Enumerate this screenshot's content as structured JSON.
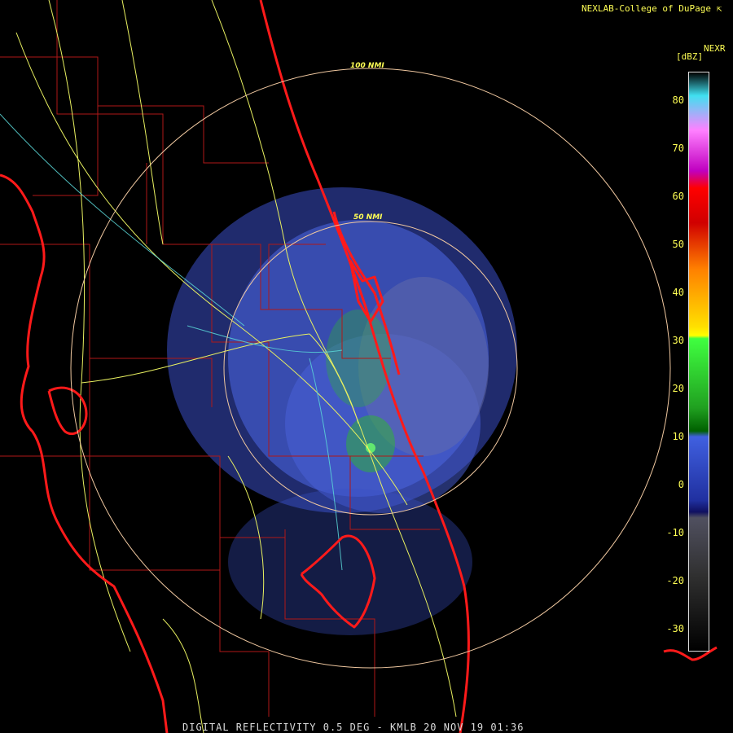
{
  "header": {
    "credit": "NEXLAB-College of DuPage"
  },
  "legend": {
    "product": "NEXR",
    "unit": "[dBZ]",
    "ticks": [
      "80",
      "70",
      "60",
      "50",
      "40",
      "30",
      "20",
      "10",
      "0",
      "-10",
      "-20",
      "-30"
    ],
    "tick_values": [
      80,
      70,
      60,
      50,
      40,
      30,
      20,
      10,
      0,
      -10,
      -20,
      -30
    ]
  },
  "rings": {
    "inner": "50 NMI",
    "outer": "100 NMI"
  },
  "footer": {
    "caption": "DIGITAL REFLECTIVITY 0.5 DEG - KMLB 20 NOV 19 01:36"
  },
  "colors": {
    "coast": "#ff1a1a",
    "counties": "#b01818",
    "roads": "#e8f060",
    "rings": "#f0c8a0",
    "echo_blue": "#4a5fd6",
    "echo_green": "#2eb82e",
    "text": "#ffff55"
  }
}
